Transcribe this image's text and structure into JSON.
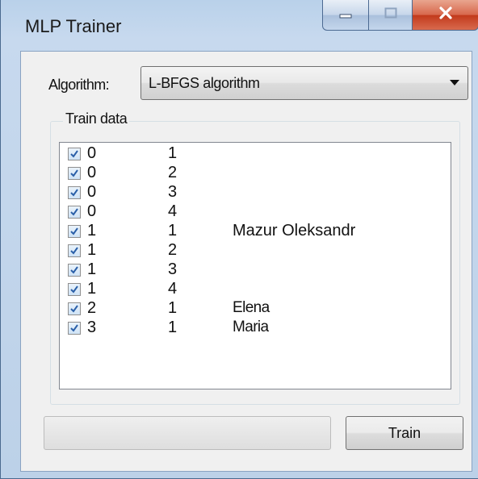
{
  "window": {
    "title": "MLP Trainer",
    "caption_buttons": [
      "minimize-icon",
      "maximize-icon",
      "close-icon"
    ]
  },
  "algorithm": {
    "label": "Algorithm:",
    "selected": "L-BFGS algorithm"
  },
  "train_data": {
    "caption": "Train data",
    "rows": [
      {
        "checked": true,
        "c0": "0",
        "c1": "1",
        "c2": ""
      },
      {
        "checked": true,
        "c0": "0",
        "c1": "2",
        "c2": ""
      },
      {
        "checked": true,
        "c0": "0",
        "c1": "3",
        "c2": ""
      },
      {
        "checked": true,
        "c0": "0",
        "c1": "4",
        "c2": ""
      },
      {
        "checked": true,
        "c0": "1",
        "c1": "1",
        "c2": "Mazur Oleksandr"
      },
      {
        "checked": true,
        "c0": "1",
        "c1": "2",
        "c2": ""
      },
      {
        "checked": true,
        "c0": "1",
        "c1": "3",
        "c2": ""
      },
      {
        "checked": true,
        "c0": "1",
        "c1": "4",
        "c2": ""
      },
      {
        "checked": true,
        "c0": "2",
        "c1": "1",
        "c2": "Elena"
      },
      {
        "checked": true,
        "c0": "3",
        "c1": "1",
        "c2": "Maria"
      }
    ]
  },
  "progress": {
    "value": 0
  },
  "train_button": {
    "label": "Train"
  },
  "colors": {
    "frame": "#bcd1e8",
    "close_button": "#c2391b",
    "client_bg": "#f0f0f0",
    "check_mark": "#2a5fa8"
  }
}
